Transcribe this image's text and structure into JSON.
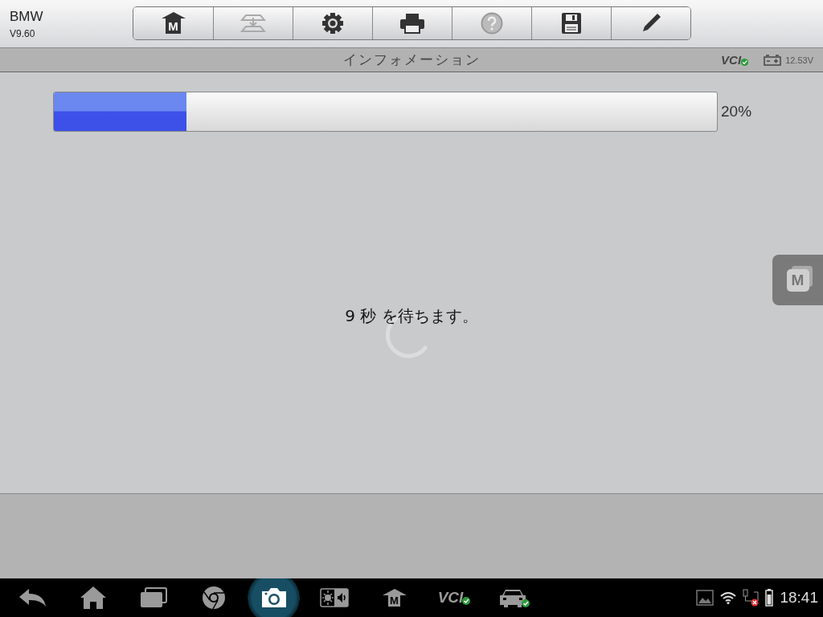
{
  "app": {
    "name": "BMW",
    "version": "V9.60"
  },
  "toolbar": [
    {
      "kind": "home",
      "glyph": "M",
      "disabled": false
    },
    {
      "kind": "vehicle",
      "disabled": true
    },
    {
      "kind": "settings",
      "disabled": false
    },
    {
      "kind": "print",
      "disabled": false
    },
    {
      "kind": "help",
      "disabled": true
    },
    {
      "kind": "save",
      "disabled": false
    },
    {
      "kind": "edit",
      "disabled": false
    }
  ],
  "title_bar": {
    "title": "インフォメーション",
    "vci": "VCI",
    "vci_connected": true,
    "voltage": "12.53V"
  },
  "progress": {
    "level": 0.2,
    "reading": "20%"
  },
  "message": "9 秒 を待ちます。",
  "float_button": {
    "glyph": "M"
  },
  "taskbar": [
    {
      "kind": "back",
      "selected": false
    },
    {
      "kind": "home",
      "selected": false
    },
    {
      "kind": "recent",
      "selected": false
    },
    {
      "kind": "browser",
      "selected": false
    },
    {
      "kind": "camera",
      "selected": true
    },
    {
      "kind": "display",
      "selected": false
    },
    {
      "kind": "m-home",
      "glyph": "M",
      "selected": false
    },
    {
      "kind": "vci",
      "glyph": "VCI",
      "selected": false
    },
    {
      "kind": "car",
      "selected": false
    }
  ],
  "status": {
    "time": "18:41"
  }
}
